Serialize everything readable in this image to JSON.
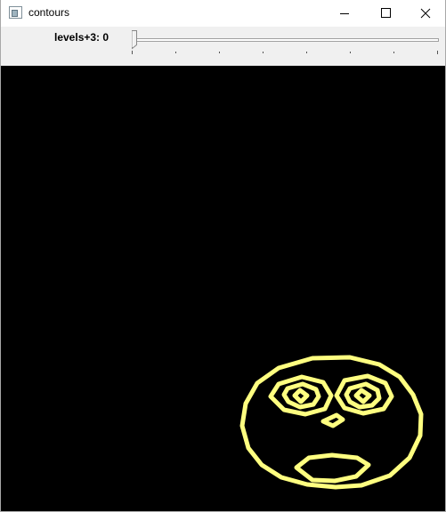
{
  "window": {
    "title": "contours",
    "icon": "app-window-icon",
    "buttons": {
      "minimize": "minimize-icon",
      "maximize": "maximize-icon",
      "close": "close-icon"
    }
  },
  "trackbar": {
    "name": "levels+3",
    "value": 0,
    "label": "levels+3: 0",
    "position_fraction": 0
  },
  "canvas": {
    "background": "#000000",
    "contour_color": "#ffff80"
  }
}
